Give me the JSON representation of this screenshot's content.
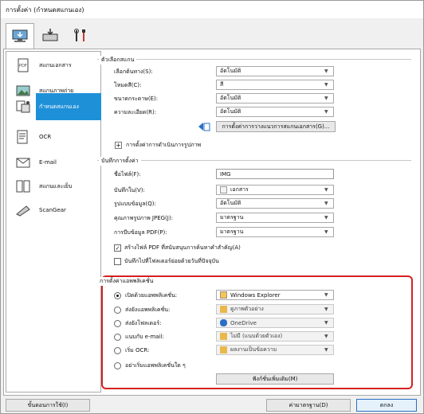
{
  "window": {
    "title": "การตั้งค่า (กำหนดสแกนเอง)"
  },
  "toolbar": {
    "tabs": [
      {
        "icon": "scan-to-computer-icon"
      },
      {
        "icon": "scan-from-panel-icon"
      },
      {
        "icon": "tools-icon"
      }
    ]
  },
  "sidebar": {
    "items": [
      {
        "label": "สแกนเอกสาร",
        "icon": "document-scan-icon"
      },
      {
        "label": "สแกนภาพถ่าย",
        "icon": "photo-scan-icon"
      },
      {
        "label": "กำหนดสแกนเอง",
        "icon": "custom-scan-icon"
      },
      {
        "label": "OCR",
        "icon": "ocr-icon"
      },
      {
        "label": "E-mail",
        "icon": "email-icon"
      },
      {
        "label": "สแกนและเย็บ",
        "icon": "stitch-icon"
      },
      {
        "label": "ScanGear",
        "icon": "scangear-icon"
      }
    ]
  },
  "scan_options": {
    "title": "ตัวเลือกสแกน",
    "fields": [
      {
        "label": "เลือกต้นทาง(S):",
        "value": "อัตโนมัติ"
      },
      {
        "label": "โหมดสี(C):",
        "value": "สี"
      },
      {
        "label": "ขนาดกระดาษ(E):",
        "value": "อัตโนมัติ"
      },
      {
        "label": "ความละเอียด(R):",
        "value": "อัตโนมัติ"
      }
    ],
    "doc_settings_button": "การตั้งค่าการวางแนวการสแกนเอกสาร(G)...",
    "image_processing": "การตั้งค่าการดำเนินการรูปภาพ"
  },
  "save_settings": {
    "title": "บันทึกการตั้งค่า",
    "fields": [
      {
        "label": "ชื่อไฟล์(F):",
        "value": "IMG",
        "type": "text"
      },
      {
        "label": "บันทึกใน(V):",
        "value": "เอกสาร",
        "type": "select"
      },
      {
        "label": "รูปแบบข้อมูล(Q):",
        "value": "อัตโนมัติ",
        "type": "select"
      },
      {
        "label": "คุณภาพรูปภาพ JPEG(J):",
        "value": "มาตรฐาน",
        "type": "select"
      },
      {
        "label": "การบีบข้อมูล PDF(P):",
        "value": "มาตรฐาน",
        "type": "select"
      }
    ],
    "checkbox_keyword_pdf": "สร้างไฟล์ PDF ที่สนับสนุนการค้นหาคำสำคัญ(A)",
    "checkbox_subfolder": "บันทึกไปที่โฟลเดอร์ย่อยด้วยวันที่ปัจจุบัน"
  },
  "app_settings": {
    "title": "การตั้งค่าแอพพลิเคชั่น",
    "options": [
      {
        "label": "เปิดด้วยแอพพลิเคชั่น:",
        "value": "Windows Explorer",
        "selected": true
      },
      {
        "label": "ส่งยังแอพพลิเคชั่น:",
        "value": "ดูภาพตัวอย่าง",
        "selected": false
      },
      {
        "label": "ส่งยังโฟลเดอร์:",
        "value": "OneDrive",
        "selected": false
      },
      {
        "label": "แนบกับ e-mail:",
        "value": "ไม่มี (แนบด้วยตัวเอง)",
        "selected": false
      },
      {
        "label": "เริ่ม OCR:",
        "value": "ผลงานเป็นข้อความ",
        "selected": false
      },
      {
        "label": "อย่าเริ่มแอพพลิเคชั่นใด ๆ",
        "value": "",
        "selected": false
      }
    ],
    "more_functions": "ฟังก์ชั่นเพิ่มเติม(M)"
  },
  "footer": {
    "instructions": "ขั้นตอนการใช้(I)",
    "defaults": "ค่ามาตรฐาน(D)",
    "ok": "ตกลง"
  }
}
